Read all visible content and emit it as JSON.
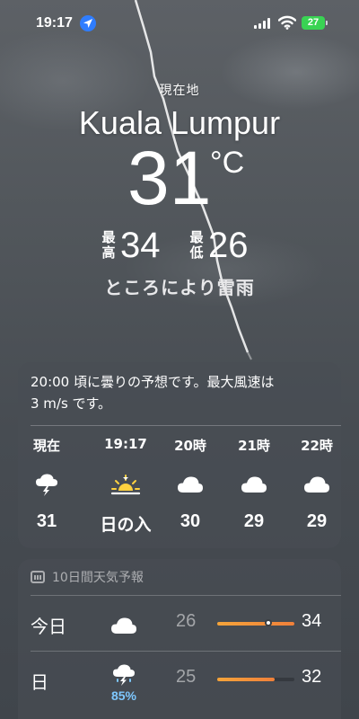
{
  "status_bar": {
    "time": "19:17",
    "location_icon": "location-arrow-icon",
    "battery": "27",
    "battery_color": "#39d353"
  },
  "header": {
    "location_label": "現在地",
    "city": "Kuala Lumpur",
    "temperature": "31",
    "unit": "°C",
    "high_tag_1": "最",
    "high_tag_2": "高",
    "high": "34",
    "low_tag_1": "最",
    "low_tag_2": "低",
    "low": "26",
    "condition": "ところにより雷雨"
  },
  "hourly": {
    "summary_line1": "20:00 頃に曇りの予想です。最大風速は",
    "summary_line2": "3 m/s です。",
    "items": [
      {
        "label": "現在",
        "icon": "thunderstorm-icon",
        "value": "31"
      },
      {
        "label": "19:17",
        "icon": "sunset-icon",
        "value": "日の入"
      },
      {
        "label": "20時",
        "icon": "cloud-icon",
        "value": "30"
      },
      {
        "label": "21時",
        "icon": "cloud-icon",
        "value": "29"
      },
      {
        "label": "22時",
        "icon": "cloud-icon",
        "value": "29"
      }
    ]
  },
  "daily": {
    "title": "10日間天気予報",
    "icon": "calendar-icon",
    "days": [
      {
        "name": "今日",
        "icon": "cloud-icon",
        "precip": "",
        "low": "26",
        "high": "34",
        "bar_start": 0.0,
        "bar_end": 1.0,
        "current_marker": 0.66
      },
      {
        "name": "日",
        "icon": "thunderstorm-icon",
        "precip": "85%",
        "low": "25",
        "high": "32",
        "bar_start": 0.0,
        "bar_end": 0.74
      }
    ],
    "bar_color": "#f0803a",
    "precip_color": "#7ec8ff"
  }
}
